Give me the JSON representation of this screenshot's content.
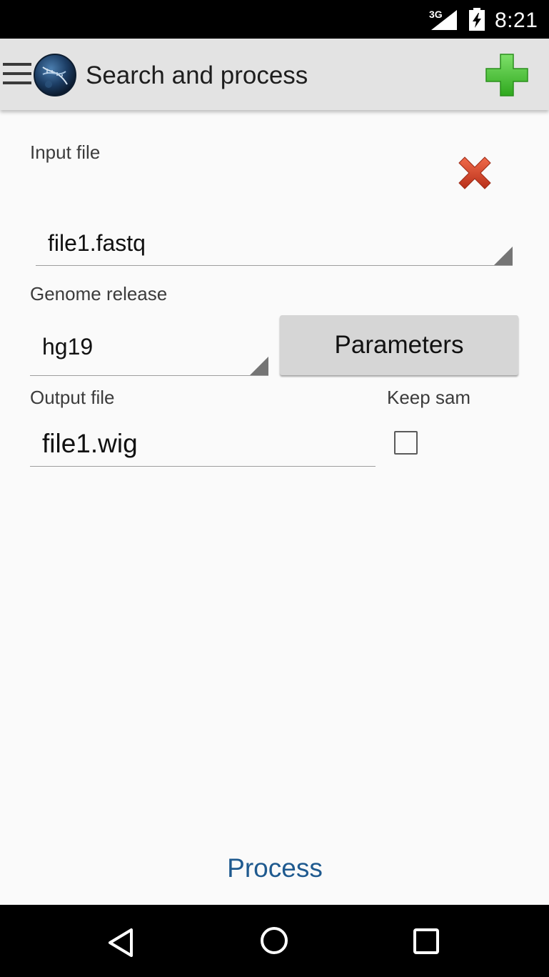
{
  "status_bar": {
    "network": "3G",
    "time": "8:21",
    "icons": [
      "signal-icon",
      "battery-charging-icon"
    ]
  },
  "action_bar": {
    "title": "Search and process",
    "icons": [
      "menu-icon",
      "app-logo-dna-globe",
      "add-plus-icon"
    ],
    "add_icon_color": "#4cc33a"
  },
  "input_file": {
    "label": "Input file",
    "selected": "file1.fastq",
    "remove_icon": "remove-x-icon",
    "remove_icon_color": "#d9472b"
  },
  "genome_release": {
    "label": "Genome release",
    "selected": "hg19",
    "parameters_button": "Parameters"
  },
  "output_file": {
    "label": "Output file",
    "value": "file1.wig"
  },
  "keep_sam": {
    "label": "Keep sam",
    "checked": false
  },
  "process_button": "Process",
  "process_color": "#1f5a8f",
  "nav_bar": {
    "icons": [
      "back-icon",
      "home-icon",
      "recents-icon"
    ]
  }
}
